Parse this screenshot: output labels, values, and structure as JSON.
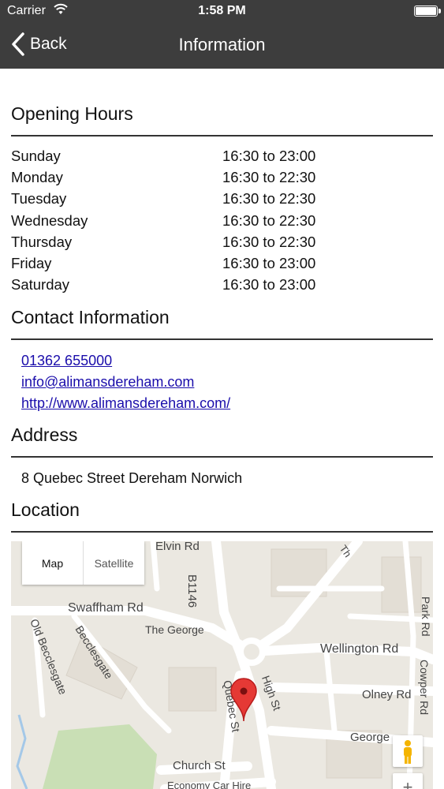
{
  "status_bar": {
    "carrier": "Carrier",
    "time": "1:58 PM"
  },
  "nav": {
    "back_label": "Back",
    "title": "Information"
  },
  "opening_hours": {
    "heading": "Opening Hours",
    "rows": [
      {
        "day": "Sunday",
        "hours": "16:30 to 23:00"
      },
      {
        "day": "Monday",
        "hours": "16:30 to 22:30"
      },
      {
        "day": "Tuesday",
        "hours": "16:30 to 22:30"
      },
      {
        "day": "Wednesday",
        "hours": "16:30 to 22:30"
      },
      {
        "day": "Thursday",
        "hours": "16:30 to 22:30"
      },
      {
        "day": "Friday",
        "hours": "16:30 to 23:00"
      },
      {
        "day": "Saturday",
        "hours": "16:30 to 23:00"
      }
    ]
  },
  "contact": {
    "heading": "Contact Information",
    "phone": "01362 655000",
    "email": "info@alimansdereham.com",
    "website": "http://www.alimansdereham.com/"
  },
  "address": {
    "heading": "Address",
    "text": "8 Quebec Street Dereham Norwich"
  },
  "location": {
    "heading": "Location",
    "map_type": {
      "map": "Map",
      "satellite": "Satellite",
      "selected": "Map"
    },
    "labels": {
      "elvin": "Elvin Rd",
      "b1146": "B1146",
      "swaffham": "Swaffham Rd",
      "the_george": "The George",
      "wellington": "Wellington Rd",
      "park": "Park Rd",
      "cowper": "Cowper Rd",
      "olney": "Olney Rd",
      "old_becclesgate": "Old Becclesgate",
      "becclesgate": "Becclesgate",
      "quebec": "Quebec St",
      "high": "High St",
      "george": "George",
      "church": "Church St",
      "economy": "Economy Car Hire",
      "the": "Th"
    },
    "zoom_in": "+"
  },
  "colors": {
    "nav_bg": "#3d3d3d",
    "link": "#1a0dab",
    "pin": "#e53935"
  }
}
